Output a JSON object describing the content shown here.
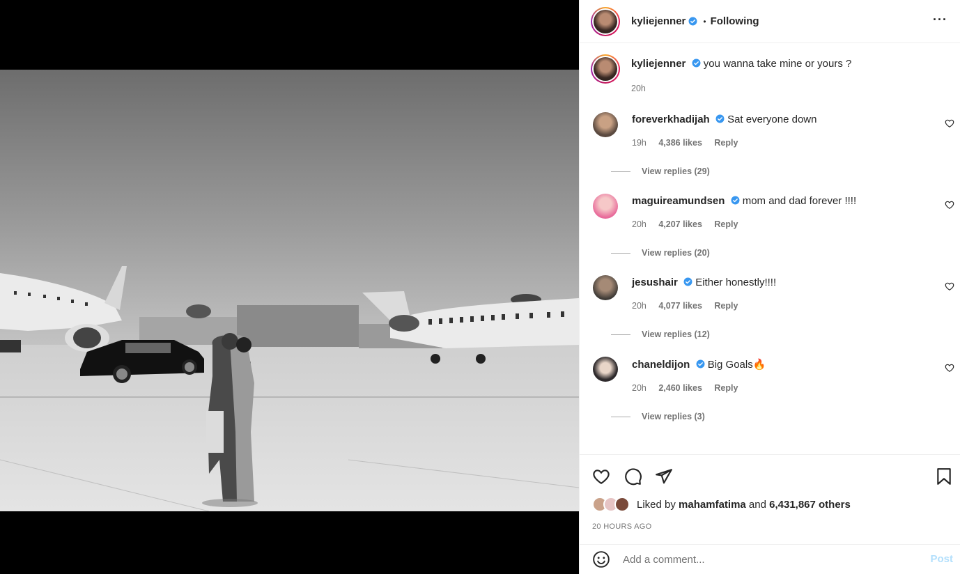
{
  "post": {
    "username": "kyliejenner",
    "follow_state": "Following",
    "separator": "•",
    "more": "···"
  },
  "caption": {
    "username": "kyliejenner",
    "text": "you wanna take mine or yours ?",
    "time": "20h"
  },
  "comments": [
    {
      "username": "foreverkhadijah",
      "text": "Sat everyone down",
      "time": "19h",
      "likes": "4,386 likes",
      "reply": "Reply",
      "replies": "View replies (29)",
      "avatar_color": "#5b4a40"
    },
    {
      "username": "maguireamundsen",
      "text": "mom and dad forever !!!!",
      "time": "20h",
      "likes": "4,207 likes",
      "reply": "Reply",
      "replies": "View replies (20)",
      "avatar_color": "#e86a9a"
    },
    {
      "username": "jesushair",
      "text": "Either honestly!!!!",
      "time": "20h",
      "likes": "4,077 likes",
      "reply": "Reply",
      "replies": "View replies (12)",
      "avatar_color": "#3e3a36"
    },
    {
      "username": "chaneldijon",
      "text": "Big Goals🔥",
      "time": "20h",
      "likes": "2,460 likes",
      "reply": "Reply",
      "replies": "View replies (3)",
      "avatar_color": "#2e2a2c"
    }
  ],
  "likes": {
    "prefix": "Liked by",
    "user": "mahamfatima",
    "middle": "and",
    "count": "6,431,867 others"
  },
  "timestamp": "20 HOURS AGO",
  "composer": {
    "placeholder": "Add a comment...",
    "post_label": "Post"
  },
  "colors": {
    "verified": "#3897f0",
    "post_disabled": "#b2dffc",
    "secondary_text": "#737373"
  },
  "icons": [
    "verified-icon",
    "more-icon",
    "heart-icon",
    "comment-icon",
    "share-icon",
    "bookmark-icon",
    "emoji-icon"
  ]
}
